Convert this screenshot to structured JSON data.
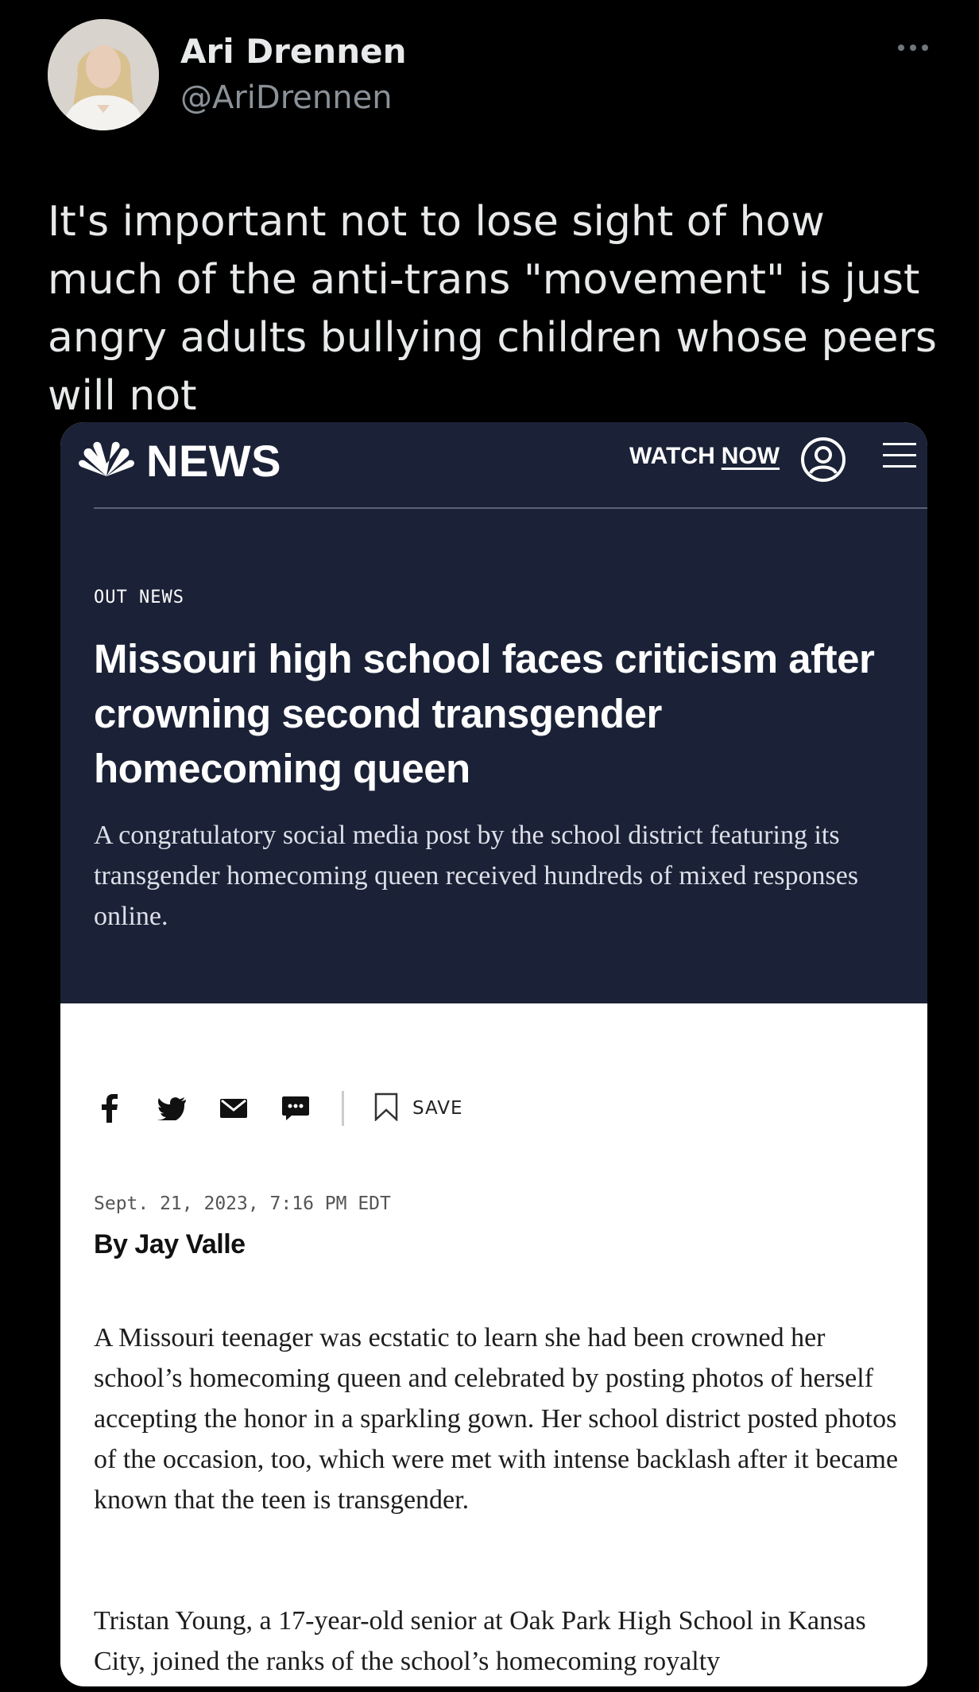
{
  "tweet": {
    "display_name": "Ari Drennen",
    "handle": "@AriDrennen",
    "text": "It's important not to lose sight of how much of the anti-trans \"movement\" is just angry adults bullying children whose peers will not"
  },
  "article": {
    "brand": "NEWS",
    "watch_label": "WATCH",
    "watch_now": "NOW",
    "section": "OUT NEWS",
    "headline": "Missouri high school faces criticism after crowning second transgender homecoming queen",
    "dek": "A congratulatory social media post by the school district featuring its transgender homecoming queen received hundreds of mixed responses online.",
    "save_label": "SAVE",
    "date": "Sept. 21, 2023, 7:16 PM EDT",
    "byline": "By Jay Valle",
    "paragraphs": [
      "A Missouri teenager was ecstatic to learn she had been crowned her school’s homecoming queen and celebrated by posting photos of herself accepting the honor in a sparkling gown. Her school district posted photos of the occasion, too, which were met with intense backlash after it became known that the teen is transgender.",
      "Tristan Young, a 17-year-old senior at Oak Park High School in Kansas City, joined the ranks of the school’s homecoming royalty"
    ]
  },
  "colors": {
    "background": "#000000",
    "hero": "#1b2237",
    "handle": "#8b9198"
  },
  "icons": [
    "more-icon",
    "peacock-logo-icon",
    "user-icon",
    "menu-icon",
    "facebook-icon",
    "twitter-icon",
    "email-icon",
    "sms-icon",
    "bookmark-icon"
  ]
}
